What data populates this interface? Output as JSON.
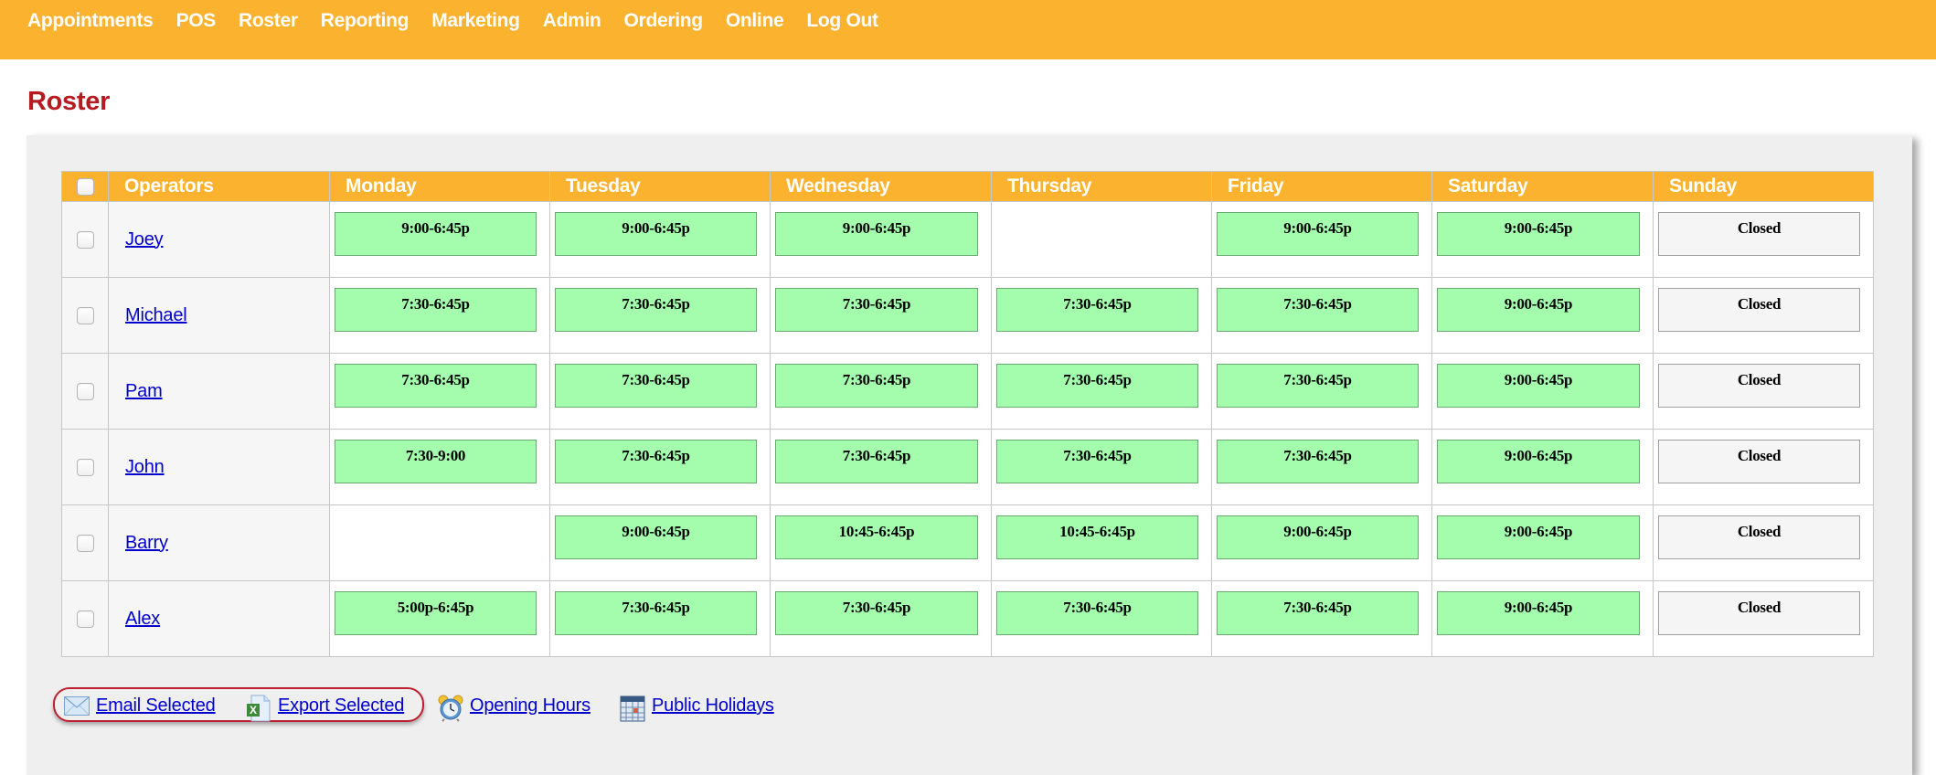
{
  "nav": {
    "items": [
      "Appointments",
      "POS",
      "Roster",
      "Reporting",
      "Marketing",
      "Admin",
      "Ordering",
      "Online",
      "Log Out"
    ]
  },
  "page": {
    "title": "Roster"
  },
  "colors": {
    "brand_orange": "#fbb22e",
    "title_red": "#b51b20",
    "shift_green": "#a4fdad",
    "closed_gray": "#f5f5f5",
    "link_blue": "#0000cc",
    "highlight_red": "#be1e2d"
  },
  "table": {
    "headers": [
      "Operators",
      "Monday",
      "Tuesday",
      "Wednesday",
      "Thursday",
      "Friday",
      "Saturday",
      "Sunday"
    ],
    "rows": [
      {
        "operator": "Joey",
        "shifts": [
          "9:00-6:45p",
          "9:00-6:45p",
          "9:00-6:45p",
          "",
          "9:00-6:45p",
          "9:00-6:45p",
          "Closed"
        ]
      },
      {
        "operator": "Michael",
        "shifts": [
          "7:30-6:45p",
          "7:30-6:45p",
          "7:30-6:45p",
          "7:30-6:45p",
          "7:30-6:45p",
          "9:00-6:45p",
          "Closed"
        ]
      },
      {
        "operator": "Pam",
        "shifts": [
          "7:30-6:45p",
          "7:30-6:45p",
          "7:30-6:45p",
          "7:30-6:45p",
          "7:30-6:45p",
          "9:00-6:45p",
          "Closed"
        ]
      },
      {
        "operator": "John",
        "shifts": [
          "7:30-9:00",
          "7:30-6:45p",
          "7:30-6:45p",
          "7:30-6:45p",
          "7:30-6:45p",
          "9:00-6:45p",
          "Closed"
        ]
      },
      {
        "operator": "Barry",
        "shifts": [
          "",
          "9:00-6:45p",
          "10:45-6:45p",
          "10:45-6:45p",
          "9:00-6:45p",
          "9:00-6:45p",
          "Closed"
        ]
      },
      {
        "operator": "Alex",
        "shifts": [
          "5:00p-6:45p",
          "7:30-6:45p",
          "7:30-6:45p",
          "7:30-6:45p",
          "7:30-6:45p",
          "9:00-6:45p",
          "Closed"
        ]
      }
    ]
  },
  "footer": {
    "links": [
      {
        "label": "Email Selected",
        "icon": "envelope-icon"
      },
      {
        "label": "Export Selected",
        "icon": "excel-export-icon"
      },
      {
        "label": "Opening Hours",
        "icon": "alarm-clock-icon"
      },
      {
        "label": "Public Holidays",
        "icon": "calendar-icon"
      }
    ]
  }
}
